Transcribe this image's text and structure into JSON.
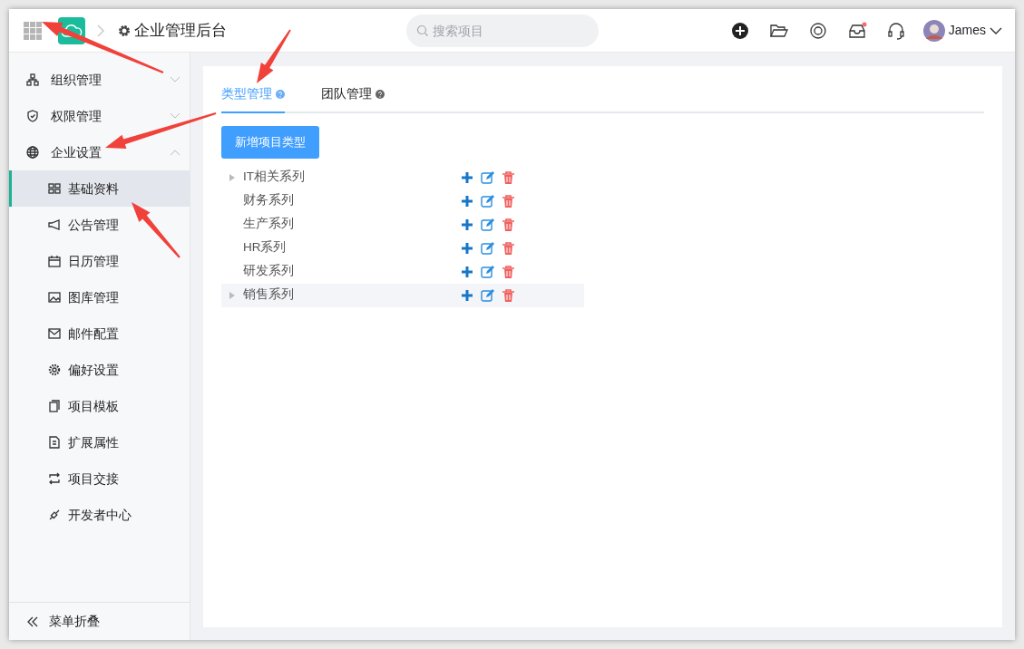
{
  "header": {
    "title": "企业管理后台",
    "search": {
      "placeholder": "搜索项目"
    },
    "notification_dot": true,
    "user": {
      "name": "James"
    }
  },
  "sidebar": {
    "items": [
      {
        "label": "组织管理",
        "expanded": false
      },
      {
        "label": "权限管理",
        "expanded": false
      },
      {
        "label": "企业设置",
        "expanded": true,
        "children": [
          {
            "label": "基础资料",
            "selected": true
          },
          {
            "label": "公告管理",
            "selected": false
          },
          {
            "label": "日历管理",
            "selected": false
          },
          {
            "label": "图库管理",
            "selected": false
          },
          {
            "label": "邮件配置",
            "selected": false
          },
          {
            "label": "偏好设置",
            "selected": false
          },
          {
            "label": "项目模板",
            "selected": false
          },
          {
            "label": "扩展属性",
            "selected": false
          },
          {
            "label": "项目交接",
            "selected": false
          },
          {
            "label": "开发者中心",
            "selected": false
          }
        ]
      }
    ],
    "collapse_label": "菜单折叠"
  },
  "tabs": [
    {
      "label": "类型管理",
      "selected": true
    },
    {
      "label": "团队管理",
      "selected": false
    }
  ],
  "add_button": "新增项目类型",
  "tree": [
    {
      "label": "IT相关系列",
      "kind": "folder",
      "selected": false
    },
    {
      "label": "财务系列",
      "kind": "leaf",
      "selected": false
    },
    {
      "label": "生产系列",
      "kind": "leaf",
      "selected": false
    },
    {
      "label": "HR系列",
      "kind": "leaf",
      "selected": false
    },
    {
      "label": "研发系列",
      "kind": "leaf",
      "selected": false
    },
    {
      "label": "销售系列",
      "kind": "folder",
      "selected": true
    }
  ],
  "annotations": [
    {
      "kind": "arrow"
    },
    {
      "kind": "arrow"
    },
    {
      "kind": "arrow"
    },
    {
      "kind": "arrow"
    }
  ]
}
